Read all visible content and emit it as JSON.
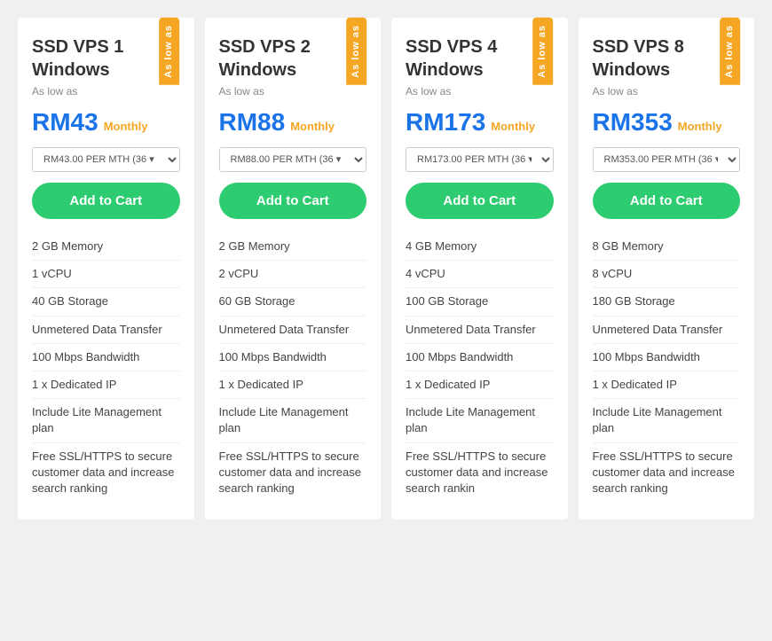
{
  "cards": [
    {
      "id": "vps1",
      "badge": "As low as",
      "title": "SSD VPS 1 Windows",
      "subtitle": "As low as",
      "price": "RM43",
      "period": "Monthly",
      "select_value": "RM43.00 PER MTH (36",
      "add_to_cart_label": "Add to Cart",
      "features": [
        "2 GB Memory",
        "1 vCPU",
        "40 GB Storage",
        "Unmetered Data Transfer",
        "100 Mbps Bandwidth",
        "1 x Dedicated IP",
        "Include Lite Management plan",
        "Free SSL/HTTPS to secure customer data and increase search ranking"
      ]
    },
    {
      "id": "vps2",
      "badge": "As low as",
      "title": "SSD VPS 2 Windows",
      "subtitle": "As low as",
      "price": "RM88",
      "period": "Monthly",
      "select_value": "RM88.00 PER MTH (36",
      "add_to_cart_label": "Add to Cart",
      "features": [
        "2 GB Memory",
        "2 vCPU",
        "60 GB Storage",
        "Unmetered Data Transfer",
        "100 Mbps Bandwidth",
        "1 x Dedicated IP",
        "Include Lite Management plan",
        "Free SSL/HTTPS to secure customer data and increase search ranking"
      ]
    },
    {
      "id": "vps4",
      "badge": "As low as",
      "title": "SSD VPS 4 Windows",
      "subtitle": "As low as",
      "price": "RM173",
      "period": "Monthly",
      "select_value": "RM173.00 PER MTH (36",
      "add_to_cart_label": "Add to Cart",
      "features": [
        "4 GB Memory",
        "4 vCPU",
        "100 GB Storage",
        "Unmetered Data Transfer",
        "100 Mbps Bandwidth",
        "1 x Dedicated IP",
        "Include Lite Management plan",
        "Free SSL/HTTPS to secure customer data and increase search rankin"
      ]
    },
    {
      "id": "vps8",
      "badge": "As low as",
      "title": "SSD VPS 8 Windows",
      "subtitle": "As low as",
      "price": "RM353",
      "period": "Monthly",
      "select_value": "RM353.00 PER MTH (36",
      "add_to_cart_label": "Add to Cart",
      "features": [
        "8 GB Memory",
        "8 vCPU",
        "180 GB Storage",
        "Unmetered Data Transfer",
        "100 Mbps Bandwidth",
        "1 x Dedicated IP",
        "Include Lite Management plan",
        "Free SSL/HTTPS to secure customer data and increase search ranking"
      ]
    }
  ]
}
